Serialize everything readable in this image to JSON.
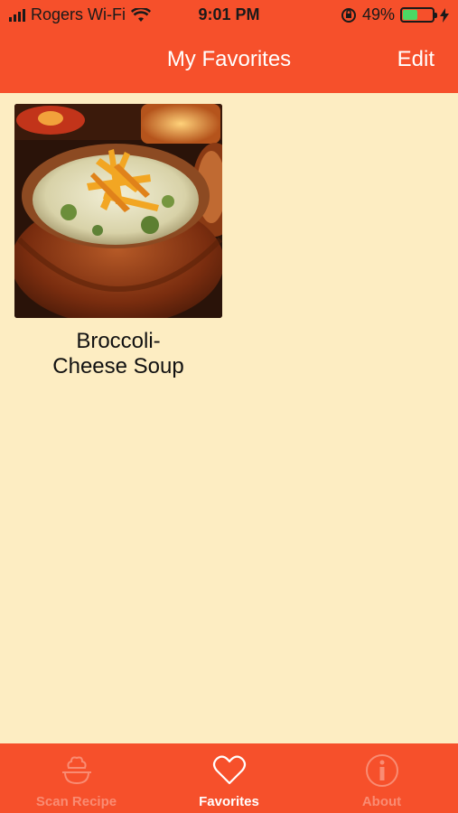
{
  "status_bar": {
    "carrier": "Rogers Wi-Fi",
    "time": "9:01 PM",
    "battery_percent": "49%",
    "battery_level": 0.49
  },
  "nav": {
    "title": "My Favorites",
    "edit_label": "Edit"
  },
  "favorites": [
    {
      "title": "Broccoli-Cheese Soup",
      "image_icon": "soup-bread-bowl-photo"
    }
  ],
  "tabbar": {
    "items": [
      {
        "label": "Scan Recipe",
        "icon": "chef-hat-icon",
        "active": false
      },
      {
        "label": "Favorites",
        "icon": "heart-icon",
        "active": true
      },
      {
        "label": "About",
        "icon": "info-icon",
        "active": false
      }
    ]
  },
  "colors": {
    "accent": "#F6502B",
    "background": "#FDEDC2",
    "tab_inactive": "#F98C73"
  }
}
